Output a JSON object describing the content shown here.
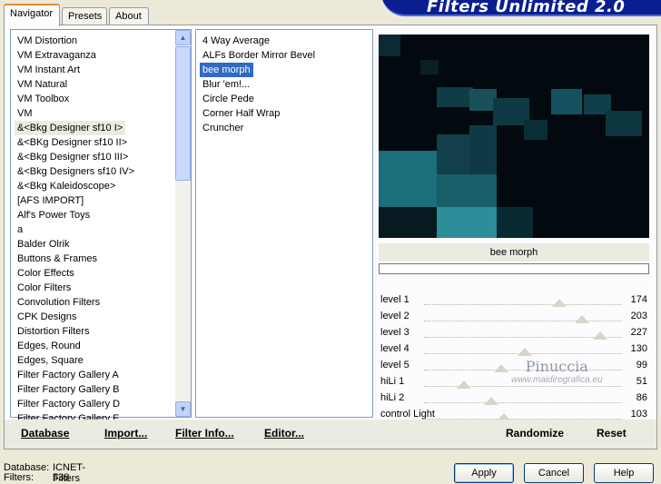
{
  "banner": {
    "title": "Filters Unlimited 2.0"
  },
  "tabs": [
    "Navigator",
    "Presets",
    "About"
  ],
  "categories": [
    "VM Distortion",
    "VM Extravaganza",
    "VM Instant Art",
    "VM Natural",
    "VM Toolbox",
    "VM",
    "&<Bkg Designer sf10 I>",
    "&<BKg Designer sf10 II>",
    "&<Bkg Designer sf10 III>",
    "&<Bkg Designers sf10 IV>",
    "&<Bkg Kaleidoscope>",
    "[AFS IMPORT]",
    "Alf's Power Toys",
    "a",
    "Balder Olrik",
    "Buttons & Frames",
    "Color Effects",
    "Color Filters",
    "Convolution Filters",
    "CPK Designs",
    "Distortion Filters",
    "Edges, Round",
    "Edges, Square",
    "Filter Factory Gallery A",
    "Filter Factory Gallery B",
    "Filter Factory Gallery D",
    "Filter Factory Gallery E"
  ],
  "filters": [
    "4 Way Average",
    "ALFs Border Mirror Bevel",
    "bee morph",
    "Blur 'em!...",
    "Circle Pede",
    "Corner Half Wrap",
    "Cruncher"
  ],
  "preview": {
    "caption": "bee morph"
  },
  "sliders": [
    {
      "label": "level 1",
      "value": 174,
      "max": 255
    },
    {
      "label": "level 2",
      "value": 203,
      "max": 255
    },
    {
      "label": "level 3",
      "value": 227,
      "max": 255
    },
    {
      "label": "level 4",
      "value": 130,
      "max": 255
    },
    {
      "label": "level 5",
      "value": 99,
      "max": 255
    },
    {
      "label": "hiLi 1",
      "value": 51,
      "max": 255
    },
    {
      "label": "hiLi 2",
      "value": 86,
      "max": 255
    },
    {
      "label": "control Light",
      "value": 103,
      "max": 255
    }
  ],
  "bottom": {
    "database": "Database",
    "import": "Import...",
    "filter_info": "Filter Info...",
    "editor": "Editor...",
    "randomize": "Randomize",
    "reset": "Reset"
  },
  "status": {
    "database_label": "Database:",
    "database_value": "ICNET-Filters",
    "filters_label": "Filters:",
    "filters_value": "538"
  },
  "dialog": {
    "apply": "Apply",
    "cancel": "Cancel",
    "help": "Help"
  },
  "watermark": {
    "name": "Pinuccia",
    "site": "www.maidiregrafica.eu"
  }
}
